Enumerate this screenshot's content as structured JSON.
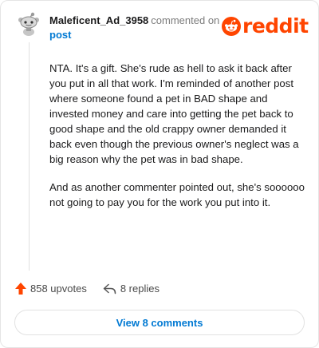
{
  "header": {
    "username": "Maleficent_Ad_3958",
    "action_text": "commented on",
    "post_link": "post",
    "logo_text": "reddit"
  },
  "comment": {
    "paragraphs": [
      "NTA. It's a gift. She's rude as hell to ask it back after you put in all that work. I'm reminded of another post where someone found a pet in BAD shape and invested money and care into getting the pet back to good shape and the old crappy owner demanded it back even though the previous owner's neglect was a big reason why the pet was in bad shape.",
      "And as another commenter pointed out, she's soooooo not going to pay you for the work you put into it."
    ]
  },
  "actions": {
    "upvotes": "858 upvotes",
    "replies": "8 replies"
  },
  "footer": {
    "view_button": "View 8 comments"
  },
  "icons": {
    "avatar": "snoo-avatar-icon",
    "logo": "reddit-snoo-icon",
    "upvote": "upvote-arrow-icon",
    "reply": "reply-arrow-icon"
  },
  "colors": {
    "brand": "#ff4500",
    "link": "#0079d3",
    "muted": "#7c7c7c"
  }
}
